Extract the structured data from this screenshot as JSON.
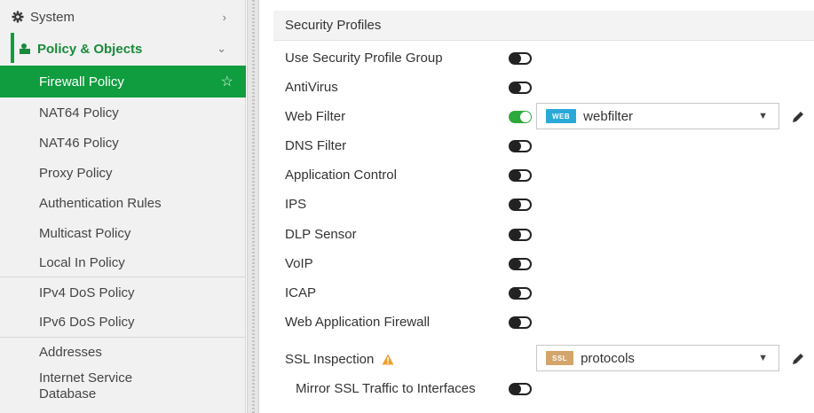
{
  "sidebar": {
    "system": "System",
    "policy_objects": "Policy & Objects",
    "items": [
      {
        "label": "Firewall Policy"
      },
      {
        "label": "NAT64 Policy"
      },
      {
        "label": "NAT46 Policy"
      },
      {
        "label": "Proxy Policy"
      },
      {
        "label": "Authentication Rules"
      },
      {
        "label": "Multicast Policy"
      },
      {
        "label": "Local In Policy"
      },
      {
        "label": "IPv4 DoS Policy"
      },
      {
        "label": "IPv6 DoS Policy"
      },
      {
        "label": "Addresses"
      },
      {
        "label_line1": "Internet Service",
        "label_line2": "Database"
      }
    ]
  },
  "main": {
    "section_title": "Security Profiles",
    "profiles": [
      {
        "label": "Use Security Profile Group",
        "enabled": false
      },
      {
        "label": "AntiVirus",
        "enabled": false
      },
      {
        "label": "Web Filter",
        "enabled": true
      },
      {
        "label": "DNS Filter",
        "enabled": false
      },
      {
        "label": "Application Control",
        "enabled": false
      },
      {
        "label": "IPS",
        "enabled": false
      },
      {
        "label": "DLP Sensor",
        "enabled": false
      },
      {
        "label": "VoIP",
        "enabled": false
      },
      {
        "label": "ICAP",
        "enabled": false
      },
      {
        "label": "Web Application Firewall",
        "enabled": false
      }
    ],
    "web_filter_select": {
      "tag": "WEB",
      "value": "webfilter"
    },
    "ssl_inspection": {
      "label": "SSL Inspection",
      "tag": "SSL",
      "value": "protocols"
    },
    "mirror_ssl": {
      "label": "Mirror SSL Traffic to Interfaces",
      "enabled": false
    }
  },
  "colors": {
    "accent_green": "#0f9d3f",
    "web_tag": "#2aa9d9",
    "ssl_tag": "#d3a46b",
    "warning": "#f0a030"
  }
}
